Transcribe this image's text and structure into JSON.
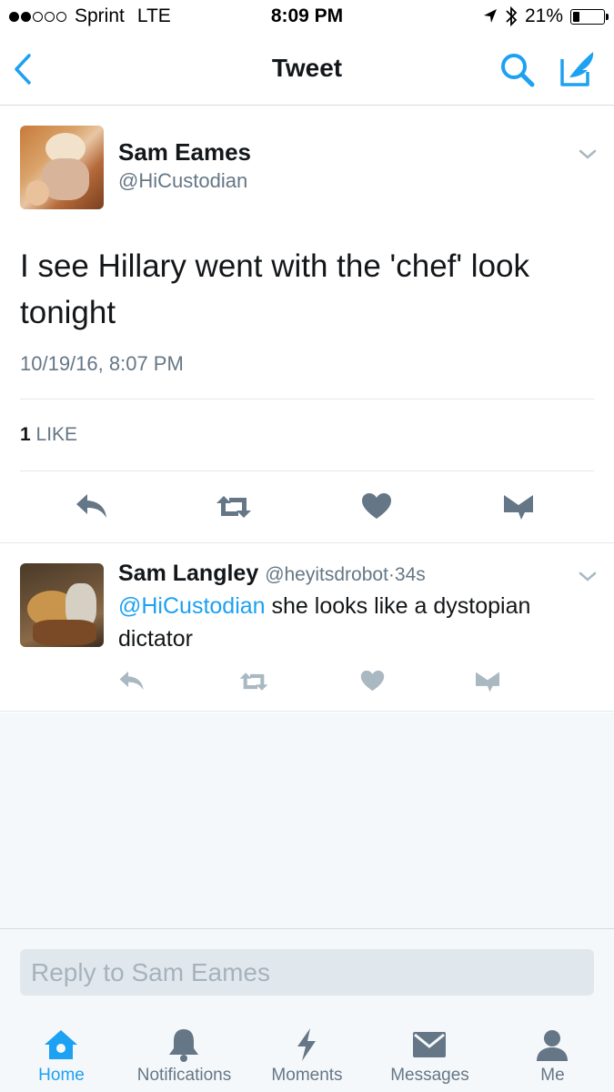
{
  "status_bar": {
    "carrier": "Sprint",
    "network": "LTE",
    "time": "8:09 PM",
    "battery": "21%",
    "battery_level": 0.21
  },
  "nav": {
    "title": "Tweet"
  },
  "tweet": {
    "author_name": "Sam Eames",
    "author_handle": "@HiCustodian",
    "text": "I see Hillary went with the 'chef' look tonight",
    "timestamp": "10/19/16, 8:07 PM",
    "like_count": "1",
    "like_label": "LIKE"
  },
  "reply": {
    "author_name": "Sam Langley",
    "author_handle": "@heyitsdrobot",
    "separator": "·",
    "age": "34s",
    "mention": "@HiCustodian",
    "text": " she looks like a dystopian dictator"
  },
  "reply_box": {
    "placeholder": "Reply to Sam Eames"
  },
  "tabs": [
    {
      "label": "Home",
      "icon": "home-icon",
      "active": true
    },
    {
      "label": "Notifications",
      "icon": "bell-icon",
      "active": false
    },
    {
      "label": "Moments",
      "icon": "lightning-icon",
      "active": false
    },
    {
      "label": "Messages",
      "icon": "envelope-icon",
      "active": false
    },
    {
      "label": "Me",
      "icon": "person-icon",
      "active": false
    }
  ],
  "colors": {
    "accent": "#1da1f2",
    "action_gray": "#657786",
    "text": "#14171a",
    "muted": "#657786",
    "background": "#f5f8fa"
  }
}
